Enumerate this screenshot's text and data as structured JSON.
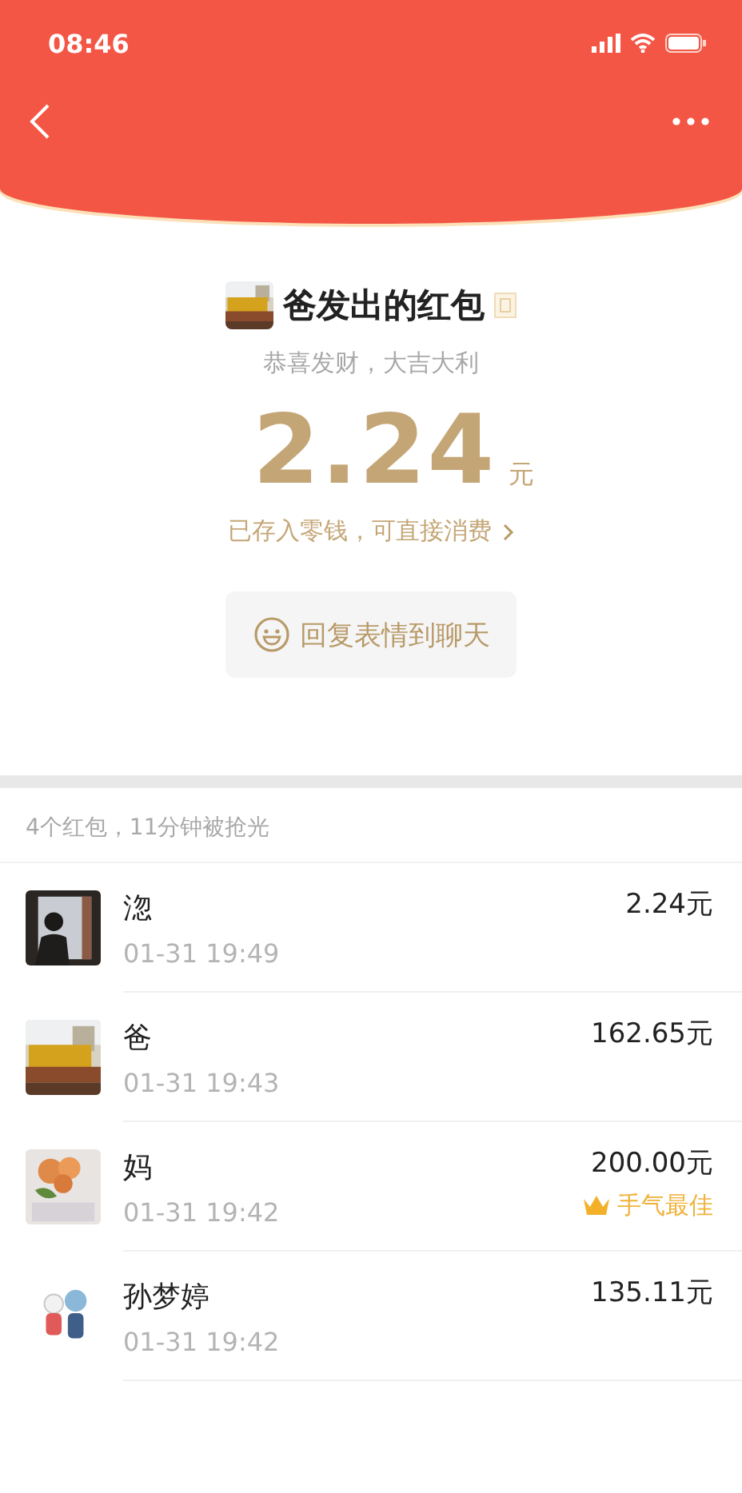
{
  "status_bar": {
    "time": "08:46"
  },
  "envelope": {
    "title": "爸发出的红包",
    "blessing": "恭喜发财，大吉大利",
    "amount": "2.24",
    "unit": "元",
    "note": "已存入零钱，可直接消费",
    "reply_button": "回复表情到聊天"
  },
  "summary": "4个红包，11分钟被抢光",
  "records": [
    {
      "name": "淴",
      "time": "01-31 19:49",
      "amount": "2.24元",
      "best": false
    },
    {
      "name": "爸",
      "time": "01-31 19:43",
      "amount": "162.65元",
      "best": false
    },
    {
      "name": "妈",
      "time": "01-31 19:42",
      "amount": "200.00元",
      "best": true,
      "best_label": "手气最佳"
    },
    {
      "name": "孙梦婷",
      "time": "01-31 19:42",
      "amount": "135.11元",
      "best": false
    }
  ]
}
